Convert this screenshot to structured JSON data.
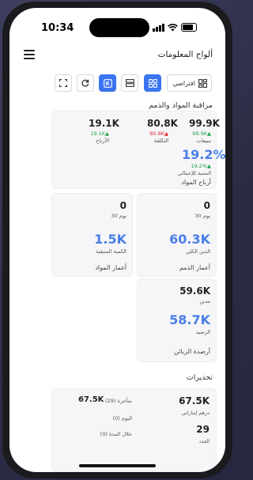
{
  "status": {
    "time": "10:34"
  },
  "appbar": {
    "title": "ألواح المعلومات"
  },
  "toolbar": {
    "view_label": "افتراضي"
  },
  "materials_section": {
    "title": "مراقبة المواد والذمم",
    "summary": {
      "sales": {
        "value": "99.9K",
        "change": "99.9K▲",
        "label": "مبيعات"
      },
      "cost": {
        "value": "80.8K",
        "change": "80.8K▲",
        "label": "التكلفة"
      },
      "profit": {
        "value": "19.1K",
        "change": "19.1K▲",
        "label": "الأرباح"
      },
      "percent": {
        "value": "19.2%",
        "change": "19.2%▲",
        "label": "النسبة للإجمالي"
      },
      "footer": "أرباح المواد"
    },
    "receivables": {
      "days_value": "0",
      "days_label": "30 يوم",
      "main_value": "60.3K",
      "main_label": "الدين الكلي",
      "footer": "أعمار الذمم"
    },
    "materials_age": {
      "days_value": "0",
      "days_label": "30 يوم",
      "main_value": "1.5K",
      "main_label": "الكمية المتبقية",
      "footer": "أعمار المواد"
    },
    "customers": {
      "debit_value": "59.6K",
      "debit_label": "مدين",
      "balance_value": "58.7K",
      "balance_label": "الرصيد",
      "footer": "أرصدة الزبائن"
    }
  },
  "alerts_section": {
    "title": "تحذيرات",
    "aed_value": "67.5K",
    "aed_label": "درهم إماراتي",
    "late_value": "67.5K",
    "late_label": "متأخرة (29)",
    "count_value": "29",
    "count_label": "العدد",
    "today_label": "اليوم (0)",
    "within_label": "خلال المدة (0)"
  },
  "colors": {
    "accent": "#3b74f0",
    "up": "#23a24d",
    "down": "#e0282e",
    "value_blue": "#4a7ee8"
  }
}
